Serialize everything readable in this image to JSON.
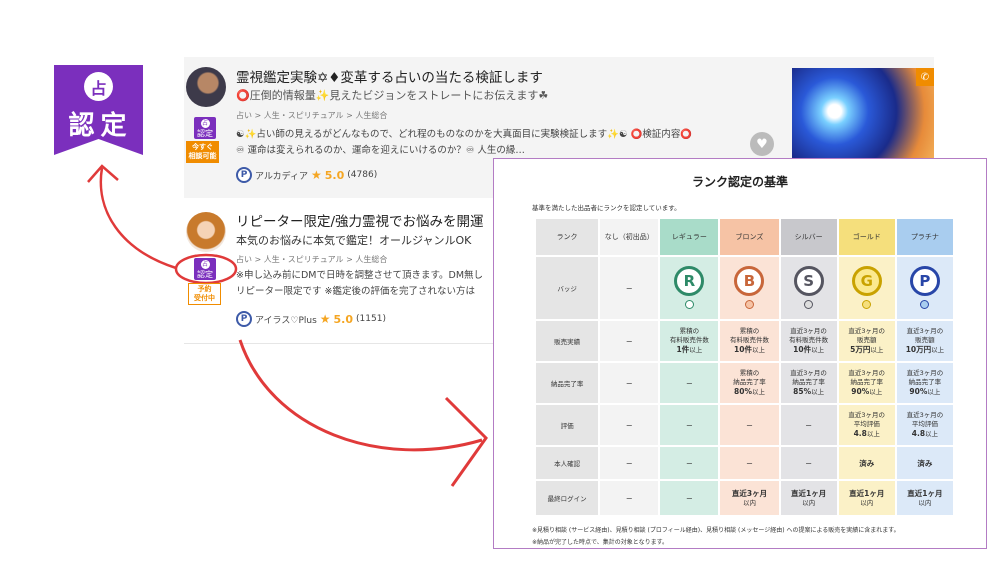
{
  "big_badge": {
    "emblem": "占",
    "text": "認定"
  },
  "listings": [
    {
      "title": "霊視鑑定実験✡♦変革する占いの当たる検証します",
      "subtitle": "⭕圧倒的情報量✨見えたビジョンをストレートにお伝えます☘",
      "crumb": "占い > 人生・スピリチュアル > 人生総合",
      "desc1": "☯✨占い師の見えるがどんなもので、どれ程のものなのかを大真面目に実験検証します✨☯ ⭕検証内容⭕",
      "desc2": "♾ 運命は変えられるのか、運命を迎えにいけるのか？♾ 人生の縁…",
      "seller": "アルカディア",
      "score": "5.0",
      "count": "(4786)",
      "badge_text": "認定",
      "status": "今すぐ\n相談可能"
    },
    {
      "title": "リピーター限定/強力霊視でお悩みを開運",
      "subtitle": "本気のお悩みに本気で鑑定！オールジャンルOK",
      "crumb": "占い > 人生・スピリチュアル > 人生総合",
      "desc1": "※申し込み前にDMで日時を調整させて頂きます。DM無し",
      "desc2": "リピーター限定です ※鑑定後の評価を完了されない方は",
      "seller": "アイラス♡Plus",
      "score": "5.0",
      "count": "(1151)",
      "badge_text": "認定",
      "status": "予約\n受付中"
    }
  ],
  "panel": {
    "title": "ランク認定の基準",
    "note": "基準を満たした出品者にランクを認定しています。",
    "footnote1": "※見積り相談 (サービス経由)、見積り相談 (プロフィール経由)、見積り相談 (メッセージ経由) への提案による販売を実績に含まれます。",
    "footnote2": "※納品が完了した時点で、集計の対象となります。",
    "headers": [
      "ランク",
      "なし（初出品）",
      "レギュラー",
      "ブロンズ",
      "シルバー",
      "ゴールド",
      "プラチナ"
    ],
    "row_labels": [
      "バッジ",
      "販売実績",
      "納品完了率",
      "評価",
      "本人確認",
      "最終ログイン"
    ],
    "dash": "ー",
    "badges": [
      {
        "letter": "R",
        "color": "#2e8a68"
      },
      {
        "letter": "B",
        "color": "#c8663a"
      },
      {
        "letter": "S",
        "color": "#555560"
      },
      {
        "letter": "G",
        "color": "#c9a200"
      },
      {
        "letter": "P",
        "color": "#2846a8"
      }
    ],
    "sales": [
      {
        "l1": "累積の",
        "l2": "有料販売件数",
        "strong": "1件",
        "suffix": "以上"
      },
      {
        "l1": "累積の",
        "l2": "有料販売件数",
        "strong": "10件",
        "suffix": "以上"
      },
      {
        "l1": "直近3ヶ月の",
        "l2": "有料販売件数",
        "strong": "10件",
        "suffix": "以上"
      },
      {
        "l1": "直近3ヶ月の",
        "l2": "販売額",
        "strong": "5万円",
        "suffix": "以上"
      },
      {
        "l1": "直近3ヶ月の",
        "l2": "販売額",
        "strong": "10万円",
        "suffix": "以上"
      }
    ],
    "completion": [
      {
        "l1": "累積の",
        "l2": "納品完了率",
        "strong": "80%",
        "suffix": "以上"
      },
      {
        "l1": "直近3ヶ月の",
        "l2": "納品完了率",
        "strong": "85%",
        "suffix": "以上"
      },
      {
        "l1": "直近3ヶ月の",
        "l2": "納品完了率",
        "strong": "90%",
        "suffix": "以上"
      },
      {
        "l1": "直近3ヶ月の",
        "l2": "納品完了率",
        "strong": "90%",
        "suffix": "以上"
      }
    ],
    "rating": [
      {
        "l1": "直近3ヶ月の",
        "l2": "平均評価",
        "strong": "4.8",
        "suffix": "以上"
      },
      {
        "l1": "直近3ヶ月の",
        "l2": "平均評価",
        "strong": "4.8",
        "suffix": "以上"
      }
    ],
    "identity": "済み",
    "login": [
      {
        "strong": "直近3ヶ月",
        "suffix": "以内"
      },
      {
        "strong": "直近1ヶ月",
        "suffix": "以内"
      },
      {
        "strong": "直近1ヶ月",
        "suffix": "以内"
      },
      {
        "strong": "直近1ヶ月",
        "suffix": "以内"
      }
    ]
  },
  "colors": {
    "purple": "#7b2fbd",
    "arrow": "#e03a3a",
    "orange": "#f08c00"
  }
}
